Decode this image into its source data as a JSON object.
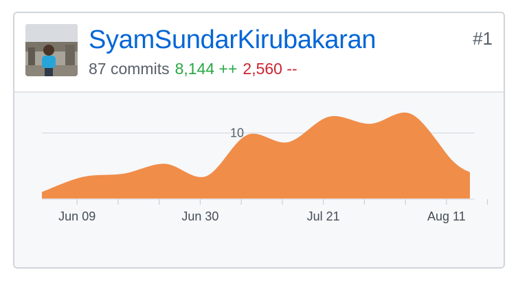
{
  "contributor": {
    "username": "SyamSundarKirubakaran",
    "rank": "#1",
    "commits_text": "87 commits",
    "additions_text": "8,144 ++",
    "deletions_text": "2,560 --",
    "avatar_icon": "user-avatar-photo"
  },
  "colors": {
    "link": "#0366d6",
    "additions": "#28a745",
    "deletions": "#cb2431",
    "area_fill": "#f08d49",
    "chart_bg": "#f6f8fa"
  },
  "chart_data": {
    "type": "area",
    "x": [
      "2018-06-03",
      "2018-06-10",
      "2018-06-17",
      "2018-06-24",
      "2018-07-01",
      "2018-07-08",
      "2018-07-15",
      "2018-07-22",
      "2018-07-29",
      "2018-08-05",
      "2018-08-12",
      "2018-08-15"
    ],
    "values": [
      1,
      3.3,
      3.8,
      5.3,
      3.4,
      9.7,
      8.6,
      12.5,
      11.4,
      12.9,
      5.8,
      4.0
    ],
    "x_tick_labels": [
      "Jun 09",
      "Jun 30",
      "Jul 21",
      "Aug 11"
    ],
    "x_ticks": [
      "2018-06-09",
      "2018-06-16",
      "2018-06-23",
      "2018-06-30",
      "2018-07-07",
      "2018-07-14",
      "2018-07-21",
      "2018-07-28",
      "2018-08-04",
      "2018-08-11",
      "2018-08-18"
    ],
    "gridline_values": [
      10
    ],
    "gridline_labels": [
      "10"
    ],
    "ylim": [
      0,
      13
    ],
    "grid": true
  }
}
